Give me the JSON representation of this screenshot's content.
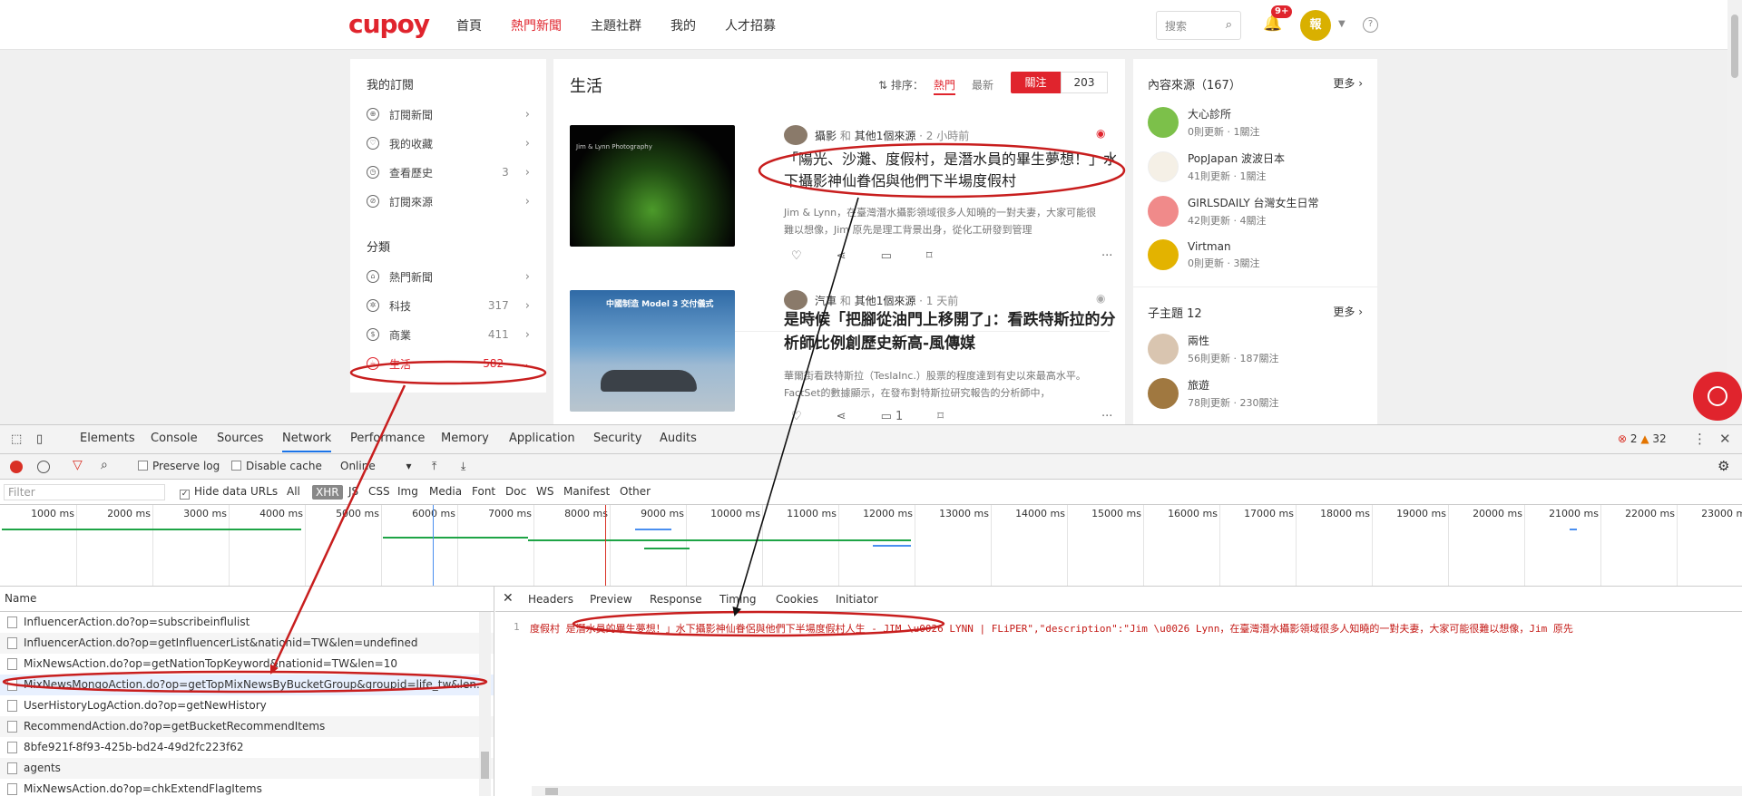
{
  "site": {
    "logo": "cupoy",
    "nav": [
      "首頁",
      "熱門新聞",
      "主題社群",
      "我的",
      "人才招募"
    ],
    "nav_active_index": 1,
    "search_placeholder": "搜索",
    "notification_badge": "9+",
    "avatar_text": "報"
  },
  "left": {
    "subs_title": "我的訂閱",
    "subs": [
      {
        "label": "訂閱新聞",
        "icon": "globe-icon",
        "count": ""
      },
      {
        "label": "我的收藏",
        "icon": "heart-icon",
        "count": ""
      },
      {
        "label": "查看歷史",
        "icon": "clock-icon",
        "count": "3"
      },
      {
        "label": "訂閱來源",
        "icon": "compass-icon",
        "count": ""
      }
    ],
    "cat_title": "分類",
    "cats": [
      {
        "label": "熱門新聞",
        "icon": "home-icon",
        "count": ""
      },
      {
        "label": "科技",
        "icon": "atom-icon",
        "count": "317"
      },
      {
        "label": "商業",
        "icon": "dollar-icon",
        "count": "411"
      },
      {
        "label": "生活",
        "icon": "cup-icon",
        "count": "582",
        "active": true
      }
    ]
  },
  "feed": {
    "title": "生活",
    "sort_label": "排序：",
    "sort_hot": "熱門",
    "sort_new": "最新",
    "follow": "關注",
    "follow_count": "203",
    "articles": [
      {
        "thumb_caption": "Jim & Lynn Photography",
        "source": "攝影",
        "and": "和",
        "others": "其他1個來源",
        "time": "· 2 小時前",
        "title": "「陽光、沙灘、度假村，是潛水員的畢生夢想！」水下攝影神仙眷侶與他們下半場度假村",
        "excerpt": "Jim & Lynn，在臺灣潛水攝影領域很多人知曉的一對夫妻，大家可能很難以想像，Jim 原先是理工背景出身，從化工研發到管理"
      },
      {
        "thumb_caption": "中國制造 Model 3 交付儀式",
        "source": "汽車",
        "and": "和",
        "others": "其他1個來源",
        "time": "· 1 天前",
        "title": "是時候「把腳從油門上移開了」：看跌特斯拉的分析師比例創歷史新高-風傳媒",
        "excerpt": "華爾街看跌特斯拉（TeslaInc.）股票的程度達到有史以來最高水平。FactSet的數據顯示，在發布對特斯拉研究報告的分析師中，",
        "comments": "1"
      }
    ],
    "more": "···"
  },
  "right": {
    "sources_title": "內容來源（167）",
    "more": "更多",
    "sources": [
      {
        "name": "大心診所",
        "stats": "0則更新 · 1關注",
        "color": "#7cc04a"
      },
      {
        "name": "PopJapan 波波日本",
        "stats": "41則更新 · 1關注",
        "color": "#f5f0e6"
      },
      {
        "name": "GIRLSDAILY 台灣女生日常",
        "stats": "42則更新 · 4關注",
        "color": "#f08a8a"
      },
      {
        "name": "Virtman",
        "stats": "0則更新 · 3關注",
        "color": "#e3b300"
      }
    ],
    "sub_title": "子主題 12",
    "subtopics": [
      {
        "name": "兩性",
        "stats": "56則更新 · 187關注",
        "color": "#d9c5b0"
      },
      {
        "name": "旅遊",
        "stats": "78則更新 · 230關注",
        "color": "#a07840"
      }
    ]
  },
  "devtools": {
    "tabs": [
      "Elements",
      "Console",
      "Sources",
      "Network",
      "Performance",
      "Memory",
      "Application",
      "Security",
      "Audits"
    ],
    "active_tab": "Network",
    "errors": "2",
    "warnings": "32",
    "preserve_log": "Preserve log",
    "disable_cache": "Disable cache",
    "throttle": "Online",
    "filter_placeholder": "Filter",
    "hide_data_urls": "Hide data URLs",
    "types": [
      "All",
      "XHR",
      "JS",
      "CSS",
      "Img",
      "Media",
      "Font",
      "Doc",
      "WS",
      "Manifest",
      "Other"
    ],
    "active_type": "XHR",
    "ticks": [
      "1000 ms",
      "2000 ms",
      "3000 ms",
      "4000 ms",
      "5000 ms",
      "6000 ms",
      "7000 ms",
      "8000 ms",
      "9000 ms",
      "10000 ms",
      "11000 ms",
      "12000 ms",
      "13000 ms",
      "14000 ms",
      "15000 ms",
      "16000 ms",
      "17000 ms",
      "18000 ms",
      "19000 ms",
      "20000 ms",
      "21000 ms",
      "22000 ms",
      "23000 ms"
    ],
    "name_header": "Name",
    "requests": [
      "InfluencerAction.do?op=subscribeinflulist",
      "InfluencerAction.do?op=getInfluencerList&nationid=TW&len=undefined",
      "MixNewsAction.do?op=getNationTopKeyword&nationid=TW&len=10",
      "MixNewsMongoAction.do?op=getTopMixNewsByBucketGroup&groupid=life_tw&len...",
      "UserHistoryLogAction.do?op=getNewHistory",
      "RecommendAction.do?op=getBucketRecommendItems",
      "8bfe921f-8f93-425b-bd24-49d2fc223f62",
      "agents",
      "MixNewsAction.do?op=chkExtendFlagItems"
    ],
    "selected_request_index": 3,
    "detail_tabs": [
      "Headers",
      "Preview",
      "Response",
      "Timing",
      "Cookies",
      "Initiator"
    ],
    "line_no": "1",
    "response_line": "度假村 是潛水員的畢生夢想！」水下攝影神仙眷侶與他們下半場度假村人生 - JIM \\u0026 LYNN | FLiPER\",\"description\":\"Jim \\u0026 Lynn，在臺灣潛水攝影領域很多人知曉的一對夫妻，大家可能很難以想像，Jim 原先"
  }
}
